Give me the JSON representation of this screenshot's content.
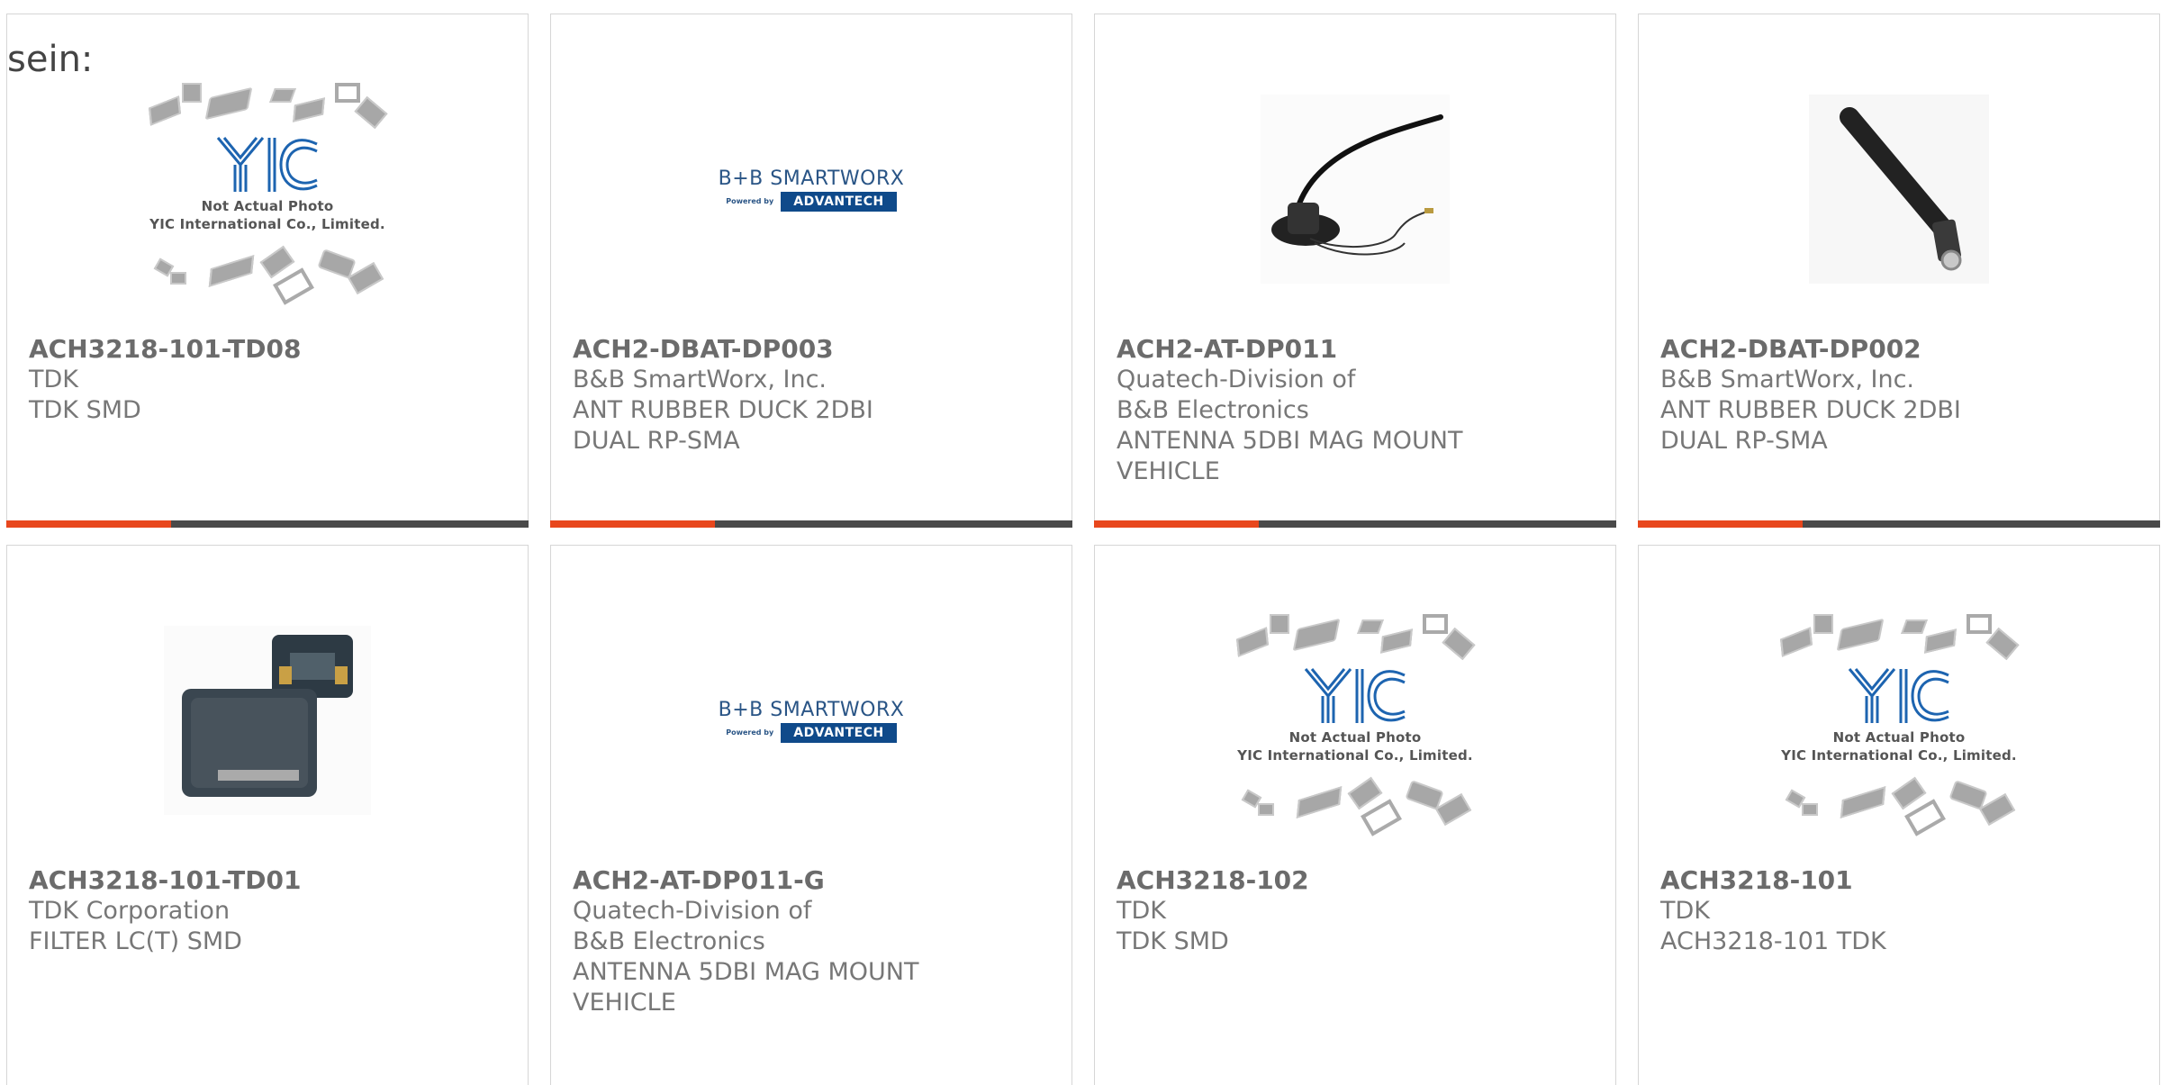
{
  "intro_text": "sein:",
  "accent_color": "#e8471d",
  "bar_color": "#4a4a4a",
  "products": [
    {
      "part": "ACH3218-101-TD08",
      "maker": "TDK",
      "desc": "TDK SMD",
      "image": "yic-placeholder"
    },
    {
      "part": "ACH2-DBAT-DP003",
      "maker": "B&B SmartWorx, Inc.",
      "desc": "ANT RUBBER DUCK 2DBI DUAL RP-SMA",
      "image": "bb-smartworx-logo"
    },
    {
      "part": "ACH2-AT-DP011",
      "maker": "Quatech-Division of B&B Electronics",
      "desc": "ANTENNA 5DBI MAG MOUNT VEHICLE",
      "image": "mag-mount-antenna-photo"
    },
    {
      "part": "ACH2-DBAT-DP002",
      "maker": "B&B SmartWorx, Inc.",
      "desc": "ANT RUBBER DUCK 2DBI DUAL RP-SMA",
      "image": "rubber-duck-antenna-photo"
    },
    {
      "part": "ACH3218-101-TD01",
      "maker": "TDK Corporation",
      "desc": "FILTER LC(T) SMD",
      "image": "smd-filter-photo"
    },
    {
      "part": "ACH2-AT-DP011-G",
      "maker": "Quatech-Division of B&B Electronics",
      "desc": "ANTENNA 5DBI MAG MOUNT VEHICLE",
      "image": "bb-smartworx-logo"
    },
    {
      "part": "ACH3218-102",
      "maker": "TDK",
      "desc": "TDK SMD",
      "image": "yic-placeholder"
    },
    {
      "part": "ACH3218-101",
      "maker": "TDK",
      "desc": "ACH3218-101 TDK",
      "image": "yic-placeholder"
    }
  ],
  "yic": {
    "line1": "Not Actual Photo",
    "line2": "YIC International Co., Limited.",
    "logo": "YIC"
  },
  "bb_logo": {
    "brand": "B+B SMARTWORX",
    "powered": "Powered by",
    "partner": "ADVANTECH"
  }
}
